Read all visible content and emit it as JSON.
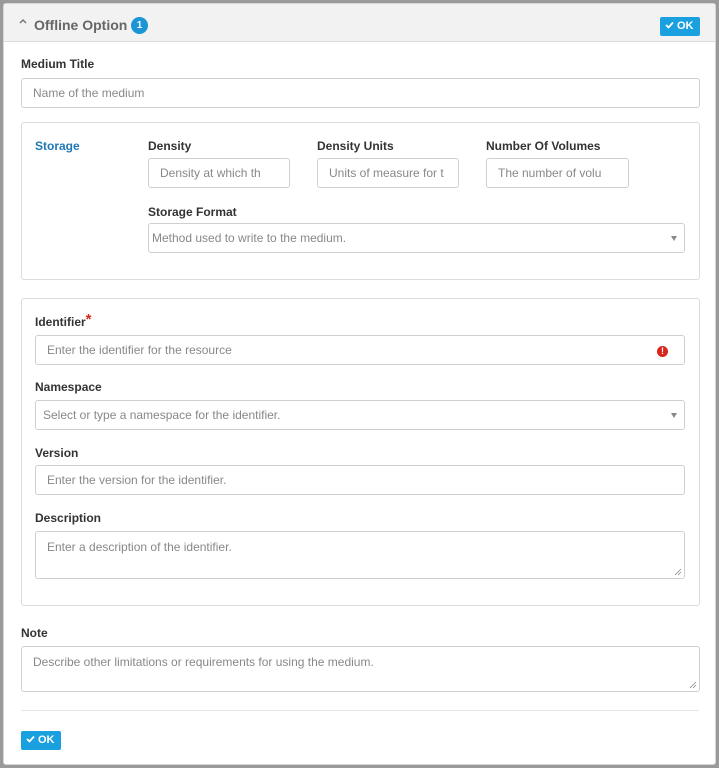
{
  "header": {
    "title": "Offline Option",
    "badge": "1",
    "ok_label": "OK"
  },
  "medium_title": {
    "label": "Medium Title",
    "placeholder": "Name of the medium"
  },
  "storage": {
    "section_label": "Storage",
    "density": {
      "label": "Density",
      "placeholder": "Density at which th"
    },
    "density_units": {
      "label": "Density Units",
      "placeholder": "Units of measure for t"
    },
    "number_of_volumes": {
      "label": "Number Of Volumes",
      "placeholder": "The number of volu"
    },
    "storage_format": {
      "label": "Storage Format",
      "placeholder": "Method used to write to the medium."
    }
  },
  "identifier": {
    "label": "Identifier",
    "required_mark": "*",
    "placeholder": "Enter the identifier for the resource",
    "error_icon": "!",
    "namespace": {
      "label": "Namespace",
      "placeholder": "Select or type a namespace for the identifier."
    },
    "version": {
      "label": "Version",
      "placeholder": "Enter the version for the identifier."
    },
    "description": {
      "label": "Description",
      "placeholder": "Enter a description of the identifier."
    }
  },
  "note": {
    "label": "Note",
    "placeholder": "Describe other limitations or requirements for using the medium."
  },
  "footer": {
    "ok_label": "OK"
  },
  "colors": {
    "accent": "#1aa0de",
    "badge": "#1a96d6",
    "storage_label": "#1f78b4",
    "error": "#d9261c"
  }
}
